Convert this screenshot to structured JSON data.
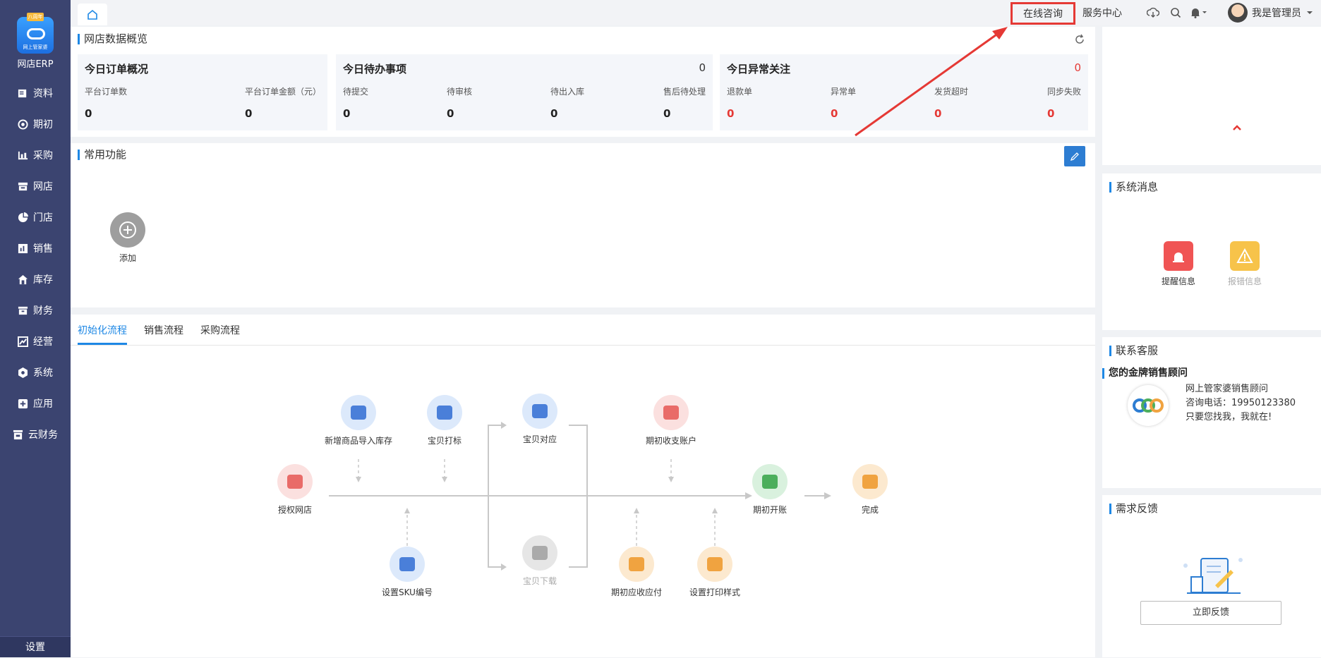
{
  "sidebar": {
    "logo_badge": "八周年",
    "logo_sub": "网上管家婆",
    "app_name": "网店ERP",
    "items": [
      {
        "label": "资料",
        "icon": "book-icon"
      },
      {
        "label": "期初",
        "icon": "target-icon"
      },
      {
        "label": "采购",
        "icon": "chart-icon"
      },
      {
        "label": "网店",
        "icon": "shop-icon"
      },
      {
        "label": "门店",
        "icon": "pie-icon"
      },
      {
        "label": "销售",
        "icon": "bar-icon"
      },
      {
        "label": "库存",
        "icon": "house-icon"
      },
      {
        "label": "财务",
        "icon": "wallet-icon"
      },
      {
        "label": "经营",
        "icon": "trend-icon"
      },
      {
        "label": "系统",
        "icon": "gear-icon"
      },
      {
        "label": "应用",
        "icon": "plus-square-icon"
      },
      {
        "label": "云财务",
        "icon": "cloud-book-icon"
      }
    ],
    "settings": "设置"
  },
  "topbar": {
    "consult": "在线咨询",
    "service": "服务中心",
    "user": "我是管理员"
  },
  "overview": {
    "title": "网店数据概览",
    "orders": {
      "title": "今日订单概况",
      "cells": [
        {
          "label": "平台订单数",
          "value": "0"
        },
        {
          "label": "平台订单金额（元）",
          "value": "0"
        }
      ]
    },
    "todo": {
      "title": "今日待办事项",
      "count": "0",
      "cells": [
        {
          "label": "待提交",
          "value": "0"
        },
        {
          "label": "待审核",
          "value": "0"
        },
        {
          "label": "待出入库",
          "value": "0"
        },
        {
          "label": "售后待处理",
          "value": "0"
        }
      ]
    },
    "abnormal": {
      "title": "今日异常关注",
      "count": "0",
      "cells": [
        {
          "label": "退款单",
          "value": "0"
        },
        {
          "label": "异常单",
          "value": "0"
        },
        {
          "label": "发货超时",
          "value": "0"
        },
        {
          "label": "同步失败",
          "value": "0"
        }
      ]
    }
  },
  "common": {
    "title": "常用功能",
    "add_label": "添加"
  },
  "process": {
    "tabs": [
      "初始化流程",
      "销售流程",
      "采购流程"
    ],
    "nodes": {
      "auth": "授权网店",
      "import": "新增商品导入库存",
      "tag": "宝贝打标",
      "sku": "设置SKU编号",
      "match": "宝贝对应",
      "download": "宝贝下载",
      "account": "期初收支账户",
      "payable": "期初应收应付",
      "print": "设置打印样式",
      "open": "期初开账",
      "done": "完成"
    }
  },
  "messages": {
    "title": "系统消息",
    "remind": "提醒信息",
    "error": "报错信息"
  },
  "contact": {
    "title": "联系客服",
    "subtitle": "您的金牌销售顾问",
    "line1": "网上管家婆销售顾问",
    "line2": "咨询电话：19950123380",
    "line3": "只要您找我，我就在!"
  },
  "feedback": {
    "title": "需求反馈",
    "button": "立即反馈"
  },
  "colors": {
    "sidebar": "#3b4470",
    "accent": "#1e88e5",
    "alert": "#e53935"
  }
}
